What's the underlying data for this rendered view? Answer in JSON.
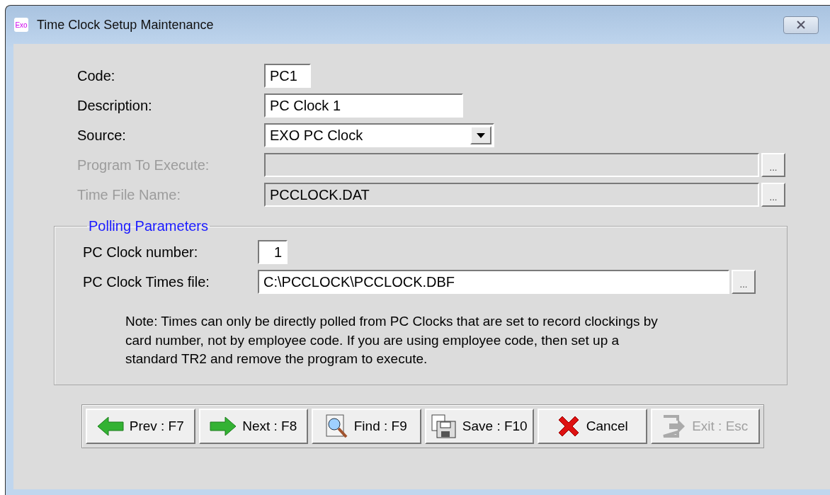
{
  "window": {
    "title": "Time Clock Setup Maintenance",
    "app_icon_text": "Exo"
  },
  "fields": [
    {
      "label": "Code:",
      "value": "PC1",
      "kind": "text",
      "disabled": false
    },
    {
      "label": "Description:",
      "value": "PC Clock 1",
      "kind": "text",
      "disabled": false
    },
    {
      "label": "Source:",
      "value": "EXO PC Clock",
      "kind": "dropdown",
      "disabled": false
    },
    {
      "label": "Program To Execute:",
      "kind": "browse",
      "disabled": true,
      "button_label": "..."
    },
    {
      "label": "Time File Name:",
      "value": "PCCLOCK.DAT",
      "kind": "browse",
      "disabled": true,
      "button_label": "..."
    }
  ],
  "polling": {
    "title": "Polling Parameters",
    "fields": [
      {
        "label": "PC Clock number:",
        "value": "1",
        "kind": "number",
        "disabled": false
      },
      {
        "label": "PC Clock Times file:",
        "value": "C:\\PCCLOCK\\PCCLOCK.DBF",
        "kind": "browse",
        "disabled": false,
        "button_label": "..."
      }
    ],
    "note": "Note: Times can only be directly polled from PC Clocks that are set to record clockings by card number, not by employee code.  If you are using employee code, then set up a standard TR2 and remove the program to execute."
  },
  "buttons": [
    {
      "label": "Prev : F7",
      "kind": "prev",
      "disabled": false
    },
    {
      "label": "Next : F8",
      "kind": "next",
      "disabled": false
    },
    {
      "label": "Find : F9",
      "kind": "find",
      "disabled": false
    },
    {
      "label": "Save : F10",
      "kind": "save",
      "disabled": false
    },
    {
      "label": "Cancel",
      "kind": "cancel",
      "disabled": false
    },
    {
      "label": "Exit : Esc",
      "kind": "exit",
      "disabled": true
    }
  ]
}
